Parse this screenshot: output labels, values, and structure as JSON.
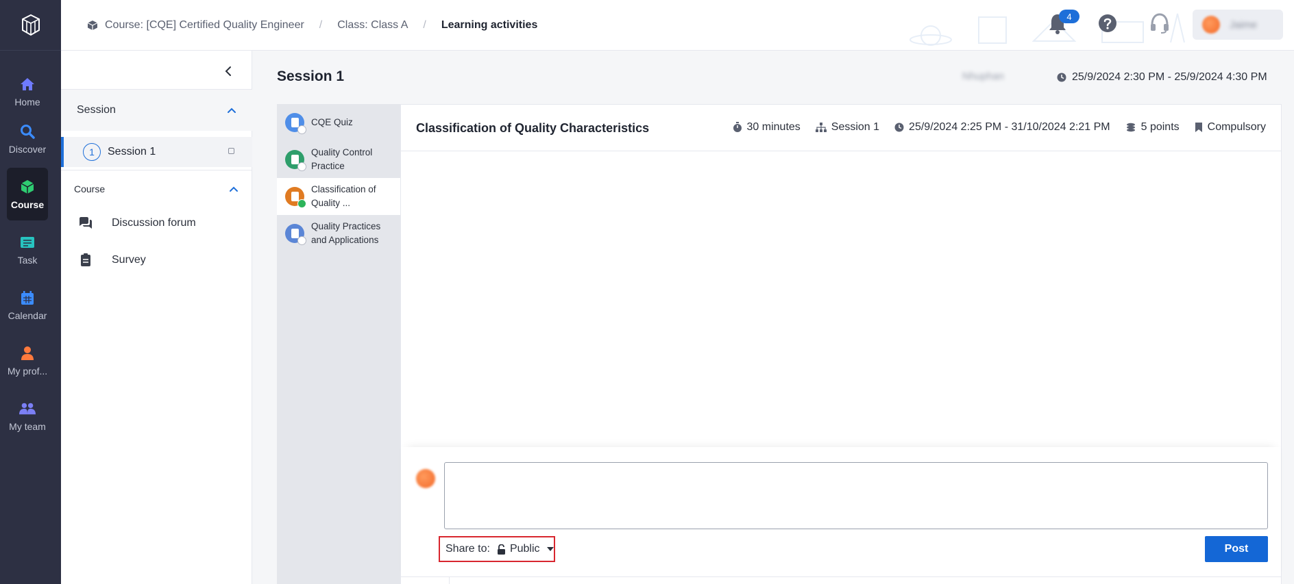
{
  "rail": {
    "items": [
      {
        "key": "home",
        "label": "Home",
        "icon": "home-icon",
        "color": "#6f7bff"
      },
      {
        "key": "discover",
        "label": "Discover",
        "icon": "search-icon",
        "color": "#3b8cff"
      },
      {
        "key": "course",
        "label": "Course",
        "icon": "cube-icon",
        "color": "#2ecc71",
        "active": true
      },
      {
        "key": "task",
        "label": "Task",
        "icon": "task-icon",
        "color": "#27c3c0"
      },
      {
        "key": "calendar",
        "label": "Calendar",
        "icon": "calendar-icon",
        "color": "#3b8cff"
      },
      {
        "key": "profile",
        "label": "My prof...",
        "icon": "user-icon",
        "color": "#ff7a3d"
      },
      {
        "key": "team",
        "label": "My team",
        "icon": "team-icon",
        "color": "#7b7ff5"
      }
    ]
  },
  "header": {
    "breadcrumb": [
      "Course: [CQE] Certified Quality Engineer",
      "Class: Class A",
      "Learning activities"
    ],
    "notification_count": "4",
    "user_name": "Jaime"
  },
  "sidebar": {
    "session_section": "Session",
    "session_number": "1",
    "session_label": "Session 1",
    "course_section": "Course",
    "links": [
      "Discussion forum",
      "Survey"
    ]
  },
  "main": {
    "title": "Session 1",
    "teacher": "Nhuphan",
    "session_time": "25/9/2024 2:30 PM - 25/9/2024 4:30 PM",
    "activities": [
      {
        "label": "CQE Quiz",
        "color": "#4f8ee8",
        "done": false
      },
      {
        "label": "Quality Control Practice",
        "color": "#2e9e6b",
        "done": false
      },
      {
        "label": "Classification of Quality ...",
        "color": "#e07b22",
        "done": true,
        "active": true
      },
      {
        "label": "Quality Practices and Applications",
        "color": "#5b86d6",
        "done": false
      }
    ],
    "activity": {
      "title": "Classification of Quality Characteristics",
      "duration": "30 minutes",
      "session": "Session 1",
      "period": "25/9/2024 2:25 PM - 31/10/2024 2:21 PM",
      "points": "5 points",
      "requirement": "Compulsory"
    },
    "comment": {
      "value": "",
      "share_label": "Share to:",
      "share_value": "Public",
      "post_label": "Post"
    }
  }
}
